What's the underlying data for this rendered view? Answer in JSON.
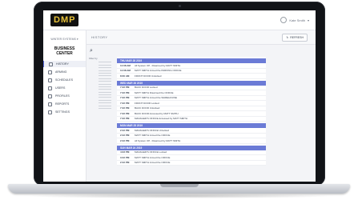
{
  "brand": {
    "logo_text": "DMP"
  },
  "header": {
    "user_label": "Kate Smith"
  },
  "sidebar": {
    "system_select": "WINTER SYSTEMS",
    "system_name": "BUSINESS CENTER",
    "items": [
      {
        "label": "HISTORY",
        "icon": "history-icon",
        "active": true
      },
      {
        "label": "ARMING",
        "icon": "lock-icon",
        "active": false
      },
      {
        "label": "SCHEDULES",
        "icon": "calendar-icon",
        "active": false
      },
      {
        "label": "USERS",
        "icon": "users-icon",
        "active": false
      },
      {
        "label": "PROFILES",
        "icon": "profile-icon",
        "active": false
      },
      {
        "label": "REPORTS",
        "icon": "folder-icon",
        "active": false
      },
      {
        "label": "SETTINGS",
        "icon": "gear-icon",
        "active": false
      }
    ]
  },
  "main": {
    "title": "HISTORY",
    "refresh_label": "REFRESH",
    "filter_label": "Filter by",
    "days": [
      {
        "date": "THU MAR 28 2019",
        "events": [
          {
            "time": "11:08 AM",
            "text": "All System Off - Disarmed by MATT SMITH"
          },
          {
            "time": "11:08 AM",
            "text": "MATT SMITH Armed the PARKING OFFICE"
          },
          {
            "time": "8:00 AM",
            "text": "FRONT DOOR Unlocked"
          }
        ]
      },
      {
        "date": "WED MAR 26 2019",
        "events": [
          {
            "time": "7:22 PM",
            "text": "BACK DOOR Locked"
          },
          {
            "time": "7:22 PM",
            "text": "MATT SMITH Disarmed the OFFICE"
          },
          {
            "time": "7:22 PM",
            "text": "MATT SMITH Armed the WAREHOUSE"
          },
          {
            "time": "7:22 PM",
            "text": "FRONT DOOR Locked"
          },
          {
            "time": "7:22 PM",
            "text": "BACK DOOR Unlocked"
          },
          {
            "time": "7:22 PM",
            "text": "BACK DOOR Accessed by MATT SMITH"
          },
          {
            "time": "7:22 PM",
            "text": "MANAGER'S OFFICE Accessed by MATT SMITH"
          }
        ]
      },
      {
        "date": "MON MAR 25 2019",
        "events": [
          {
            "time": "2:42 PM",
            "text": "MANAGER'S OFFICE Unlocked"
          },
          {
            "time": "2:42 PM",
            "text": "MATT SMITH Armed the OFFICE"
          },
          {
            "time": "2:42 PM",
            "text": "All System Off - Disarmed by MATT SMITH"
          }
        ]
      },
      {
        "date": "SUN MAR 24 2019",
        "events": [
          {
            "time": "4:23 PM",
            "text": "MANAGER'S OFFICE Locked"
          },
          {
            "time": "3:42 PM",
            "text": "MATT SMITH Armed the OFFICE"
          },
          {
            "time": "2:42 PM",
            "text": "MATT SMITH Armed the OFFICE"
          }
        ]
      }
    ]
  },
  "colors": {
    "accent": "#6b7bd6",
    "logo_bg": "#111111",
    "logo_text": "#e8c23a"
  }
}
